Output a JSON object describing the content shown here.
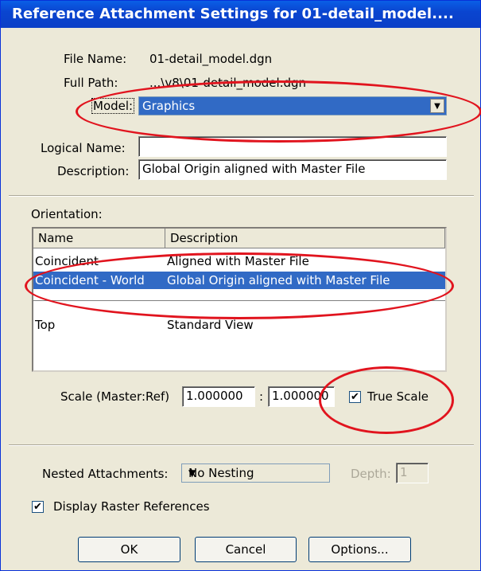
{
  "title": "Reference Attachment Settings for 01-detail_model....",
  "file_name": {
    "label": "File Name:",
    "value": "01-detail_model.dgn"
  },
  "full_path": {
    "label": "Full Path:",
    "value": "...\\v8\\01-detail_model.dgn"
  },
  "model": {
    "label": "Model:",
    "value": "Graphics"
  },
  "logical_name": {
    "label": "Logical Name:",
    "value": ""
  },
  "description": {
    "label": "Description:",
    "value": "Global Origin aligned with Master File"
  },
  "orientation": {
    "label": "Orientation:",
    "columns": [
      "Name",
      "Description"
    ],
    "rows": [
      {
        "name": "Coincident",
        "description": "Aligned with Master File"
      },
      {
        "name": "Coincident - World",
        "description": "Global Origin aligned with Master File"
      },
      {
        "name": "Top",
        "description": "Standard View"
      }
    ],
    "selected_index": 1
  },
  "scale": {
    "label": "Scale (Master:Ref)",
    "master": "1.000000",
    "separator": ":",
    "ref": "1.000000"
  },
  "true_scale": {
    "label": "True Scale",
    "checked": true
  },
  "nested": {
    "label": "Nested Attachments:",
    "value": "No Nesting"
  },
  "depth": {
    "label": "Depth:",
    "value": "1"
  },
  "display_raster": {
    "label": "Display Raster References",
    "checked": true
  },
  "buttons": {
    "ok": "OK",
    "cancel": "Cancel",
    "options": "Options..."
  },
  "annotation_color": "#e1141e"
}
